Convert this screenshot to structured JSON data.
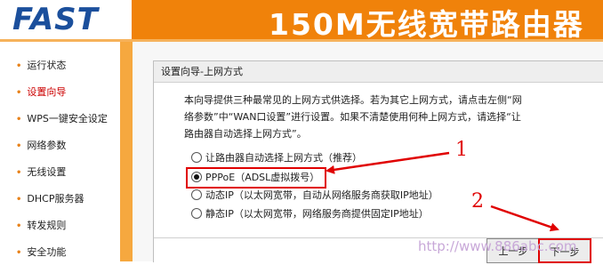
{
  "header": {
    "logo": "FAST",
    "product_title": "150M无线宽带路由器"
  },
  "sidebar": {
    "items": [
      {
        "label": "运行状态",
        "active": false
      },
      {
        "label": "设置向导",
        "active": true
      },
      {
        "label": "WPS一键安全设定",
        "active": false
      },
      {
        "label": "网络参数",
        "active": false
      },
      {
        "label": "无线设置",
        "active": false
      },
      {
        "label": "DHCP服务器",
        "active": false
      },
      {
        "label": "转发规则",
        "active": false
      },
      {
        "label": "安全功能",
        "active": false
      }
    ]
  },
  "wizard": {
    "title": "设置向导-上网方式",
    "description_lines": [
      "本向导提供三种最常见的上网方式供选择。若为其它上网方式，请点击左侧“网",
      "络参数”中“WAN口设置”进行设置。如果不清楚使用何种上网方式，请选择“让",
      "路由器自动选择上网方式”。"
    ],
    "options": [
      {
        "label": "让路由器自动选择上网方式（推荐）",
        "checked": false
      },
      {
        "label": "PPPoE（ADSL虚拟拨号）",
        "checked": true
      },
      {
        "label": "动态IP（以太网宽带，自动从网络服务商获取IP地址）",
        "checked": false
      },
      {
        "label": "静态IP（以太网宽带，网络服务商提供固定IP地址）",
        "checked": false
      }
    ],
    "back_label": "上一步",
    "next_label": "下一步"
  },
  "annotations": {
    "marker1": "1",
    "marker2": "2",
    "watermark": "http://www.886abc.com"
  },
  "colors": {
    "header": "#f0820a",
    "logo": "#1b4f9c",
    "highlight": "#e00000",
    "active_menu": "#cc0000"
  }
}
